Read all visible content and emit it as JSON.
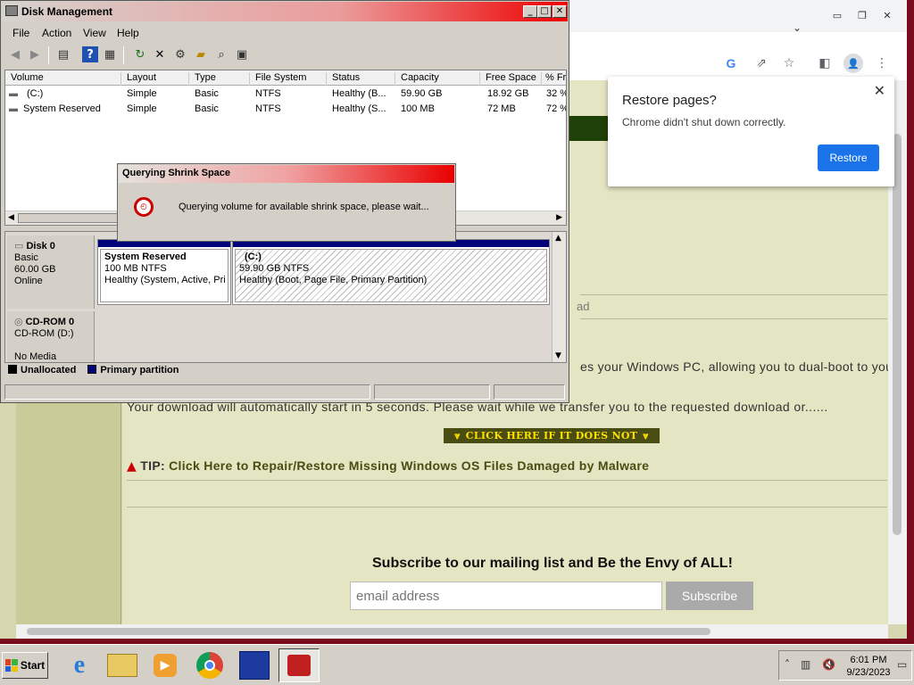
{
  "chrome": {
    "window_controls": {
      "minimize": "▭",
      "restore": "❐",
      "close": "✕"
    },
    "tab_search_icon": "⌄",
    "toolbar_icons": {
      "google": "G",
      "share": "⇗",
      "bookmark": "☆",
      "sidepanel": "◧",
      "profile": "👤",
      "menu": "⋮"
    },
    "restore_popup": {
      "title": "Restore pages?",
      "message": "Chrome didn't shut down correctly.",
      "button": "Restore",
      "close": "✕"
    },
    "page": {
      "partial_ad": "ad",
      "partial_description": "es your Windows PC, allowing you to dual-boot to you",
      "download_text": "Your download will automatically start in 5 seconds. Please wait while we transfer you to the requested download or......",
      "click_here": "CLICK HERE IF IT DOES NOT",
      "tip_label": "TIP:",
      "tip_link": "Click Here to Repair/Restore Missing Windows OS Files Damaged by Malware",
      "subscribe_heading": "Subscribe to our mailing list and Be the Envy of ALL!",
      "email_placeholder": "email address",
      "subscribe_button": "Subscribe"
    }
  },
  "disk_management": {
    "title": "Disk Management",
    "controls": {
      "minimize": "_",
      "maximize": "□",
      "close": "✕"
    },
    "menu": [
      "File",
      "Action",
      "View",
      "Help"
    ],
    "toolbar_icons": [
      "back-icon",
      "forward-icon",
      "properties-icon",
      "help-icon",
      "console-icon",
      "refresh-icon",
      "delete-icon",
      "settings-icon",
      "open-icon",
      "search-icon",
      "drive-icon"
    ],
    "columns": [
      "Volume",
      "Layout",
      "Type",
      "File System",
      "Status",
      "Capacity",
      "Free Space",
      "% Fr"
    ],
    "volumes": [
      {
        "volume": "(C:)",
        "layout": "Simple",
        "type": "Basic",
        "fs": "NTFS",
        "status": "Healthy (B...",
        "capacity": "59.90 GB",
        "free": "18.92 GB",
        "pct": "32 %"
      },
      {
        "volume": "System Reserved",
        "layout": "Simple",
        "type": "Basic",
        "fs": "NTFS",
        "status": "Healthy (S...",
        "capacity": "100 MB",
        "free": "72 MB",
        "pct": "72 %"
      }
    ],
    "disks": [
      {
        "name": "Disk 0",
        "type": "Basic",
        "size": "60.00 GB",
        "state": "Online"
      },
      {
        "name": "CD-ROM 0",
        "type": "CD-ROM (D:)",
        "state": "No Media"
      }
    ],
    "partitions": [
      {
        "name": "System Reserved",
        "size": "100 MB NTFS",
        "status": "Healthy (System, Active, Pri"
      },
      {
        "name": "(C:)",
        "size": "59.90 GB NTFS",
        "status": "Healthy (Boot, Page File, Primary Partition)"
      }
    ],
    "legend": [
      {
        "label": "Unallocated",
        "color": "#000000"
      },
      {
        "label": "Primary partition",
        "color": "#00007b"
      }
    ],
    "shrink_dialog": {
      "title": "Querying Shrink Space",
      "message": "Querying volume for available shrink space, please wait..."
    }
  },
  "taskbar": {
    "start": "Start",
    "apps": [
      "internet-explorer",
      "file-explorer",
      "media-player",
      "chrome",
      "disk-utility",
      "disk-management"
    ],
    "time": "6:01 PM",
    "date": "9/23/2023"
  }
}
